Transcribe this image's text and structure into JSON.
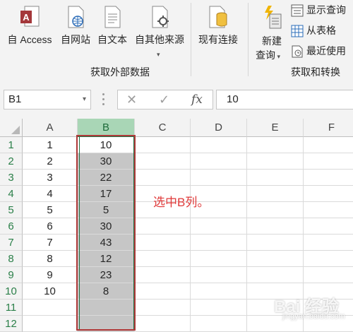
{
  "ribbon": {
    "get_external": {
      "from_access": "自 Access",
      "from_web": "自网站",
      "from_text": "自文本",
      "from_other": "自其他来源",
      "existing_connections": "现有连接",
      "group_label": "获取外部数据"
    },
    "get_transform": {
      "new_query_line1": "新建",
      "new_query_line2": "查询",
      "show_queries": "显示查询",
      "from_table": "从表格",
      "recent_sources": "最近使用",
      "group_label": "获取和转换"
    }
  },
  "formula_bar": {
    "name_box": "B1",
    "cancel_symbol": "✕",
    "enter_symbol": "✓",
    "fx_symbol": "fx",
    "value": "10"
  },
  "sheet": {
    "columns": [
      "A",
      "B",
      "C",
      "D",
      "E",
      "F"
    ],
    "rows": [
      "1",
      "2",
      "3",
      "4",
      "5",
      "6",
      "7",
      "8",
      "9",
      "10",
      "11",
      "12"
    ],
    "column_a": [
      "1",
      "2",
      "3",
      "4",
      "5",
      "6",
      "7",
      "8",
      "9",
      "10",
      "",
      ""
    ],
    "column_b": [
      "10",
      "30",
      "22",
      "17",
      "5",
      "30",
      "43",
      "12",
      "23",
      "8",
      "",
      ""
    ],
    "selected_column": "B",
    "active_cell": "B1"
  },
  "annotation": "选中B列。",
  "watermark": "Bai 经验",
  "watermark_sub": "jingyan.baidu.com",
  "colors": {
    "selection_header": "#a9d6b6",
    "selection_fill": "#c6c6c6",
    "annotation": "#e03a3a",
    "excel_green": "#217346"
  }
}
